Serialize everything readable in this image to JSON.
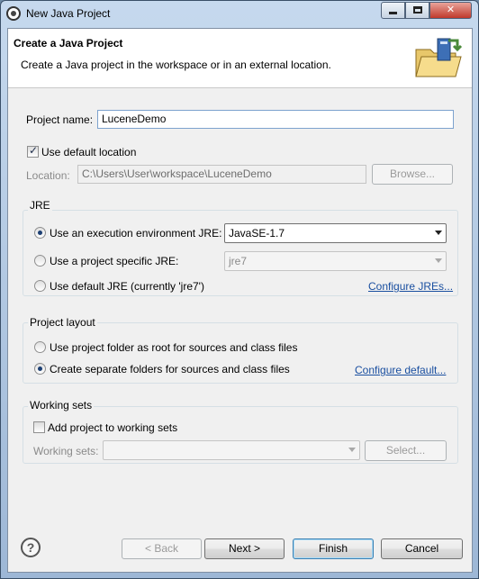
{
  "window": {
    "title": "New Java Project"
  },
  "banner": {
    "title": "Create a Java Project",
    "description": "Create a Java project in the workspace or in an external location."
  },
  "project": {
    "name_label": "Project name:",
    "name_value": "LuceneDemo",
    "use_default_location_label": "Use default location",
    "use_default_location_checked": true,
    "location_label": "Location:",
    "location_value": "C:\\Users\\User\\workspace\\LuceneDemo",
    "browse_label": "Browse..."
  },
  "jre": {
    "group_title": "JRE",
    "options": [
      {
        "label": "Use an execution environment JRE:",
        "selected": true
      },
      {
        "label": "Use a project specific JRE:",
        "selected": false
      },
      {
        "label": "Use default JRE (currently 'jre7')",
        "selected": false
      }
    ],
    "environment_value": "JavaSE-1.7",
    "specific_value": "jre7",
    "configure_link": "Configure JREs..."
  },
  "layout": {
    "group_title": "Project layout",
    "options": [
      {
        "label": "Use project folder as root for sources and class files",
        "selected": false
      },
      {
        "label": "Create separate folders for sources and class files",
        "selected": true
      }
    ],
    "configure_link": "Configure default..."
  },
  "working_sets": {
    "group_title": "Working sets",
    "add_label": "Add project to working sets",
    "add_checked": false,
    "sets_label": "Working sets:",
    "sets_value": "",
    "select_label": "Select..."
  },
  "footer": {
    "help_glyph": "?",
    "back_label": "< Back",
    "next_label": "Next >",
    "finish_label": "Finish",
    "cancel_label": "Cancel"
  },
  "icons": {
    "app": "eclipse-icon",
    "banner": "java-project-folder-icon",
    "help": "help-icon"
  },
  "colors": {
    "link": "#1a4fa0",
    "title_bar": "#c6d9ee",
    "close_button": "#c0392b"
  }
}
